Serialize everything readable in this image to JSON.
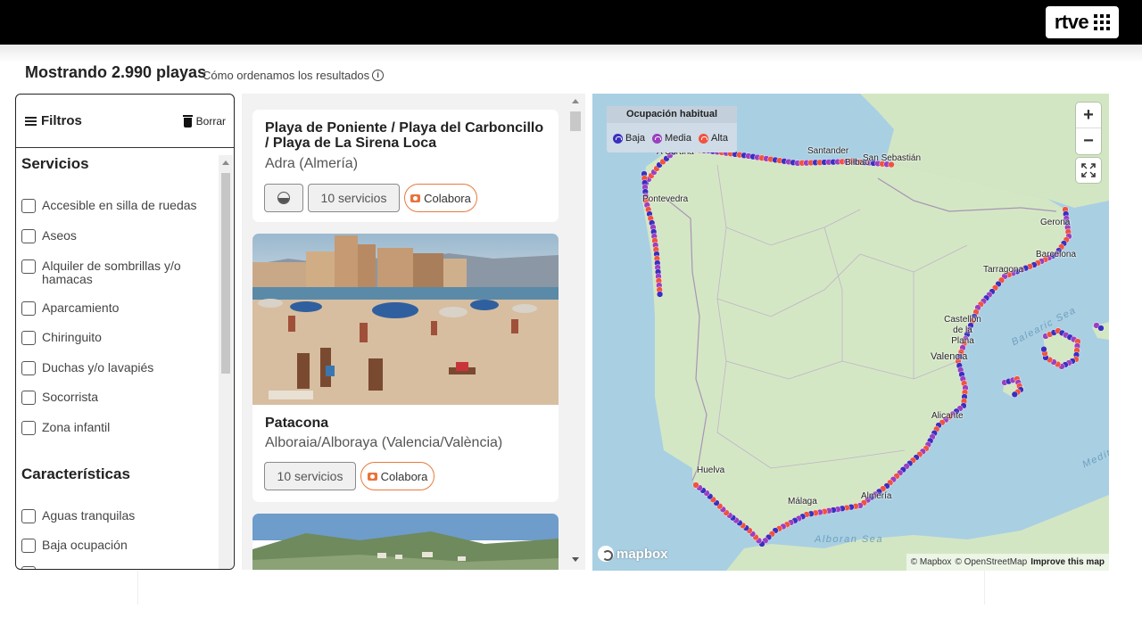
{
  "header": {
    "logo_text": "rtve",
    "bar_color": "#000000"
  },
  "page": {
    "title": "Mostrando 2.990 playas",
    "how_we_sort": "Cómo ordenamos los resultados"
  },
  "filters": {
    "title": "Filtros",
    "clear_label": "Borrar",
    "sections": [
      {
        "title": "Servicios",
        "options": [
          "Accesible en silla de ruedas",
          "Aseos",
          "Alquiler de sombrillas y/o hamacas",
          "Aparcamiento",
          "Chiringuito",
          "Duchas y/o lavapiés",
          "Socorrista",
          "Zona infantil"
        ]
      },
      {
        "title": "Características",
        "options": [
          "Aguas tranquilas",
          "Baja ocupación"
        ]
      }
    ]
  },
  "results": [
    {
      "name": "Playa de Poniente / Playa del Carboncillo / Playa de La Sirena Loca",
      "location": "Adra (Almería)",
      "services_label": "10 servicios",
      "collab_label": "Colabora",
      "has_photo": false
    },
    {
      "name": "Patacona",
      "location": "Alboraia/Alboraya (Valencia/València)",
      "services_label": "10 servicios",
      "collab_label": "Colabora",
      "has_photo": true
    }
  ],
  "map": {
    "legend": {
      "title": "Ocupación habitual",
      "items": [
        {
          "label": "Baja",
          "color": "#3b2fbf"
        },
        {
          "label": "Media",
          "color": "#9b3fc0"
        },
        {
          "label": "Alta",
          "color": "#f0533e"
        }
      ]
    },
    "zoom_in": "+",
    "zoom_out": "−",
    "cities": [
      "A Coruña",
      "Santander",
      "Bilbao",
      "San Sebastián",
      "Pontevedra",
      "Gerona",
      "Barcelona",
      "Tarragona",
      "Castellón de la Plana",
      "Valencia",
      "Alicante",
      "Huelva",
      "Málaga",
      "Almería"
    ],
    "seas": [
      "Balearic Sea",
      "Alboran Sea",
      "Medite"
    ],
    "logo": "mapbox",
    "attribution": {
      "mapbox": "© Mapbox",
      "osm": "© OpenStreetMap",
      "improve": "Improve this map"
    },
    "land_color": "#d4e7c4",
    "sea_color": "#a9cfe3"
  }
}
